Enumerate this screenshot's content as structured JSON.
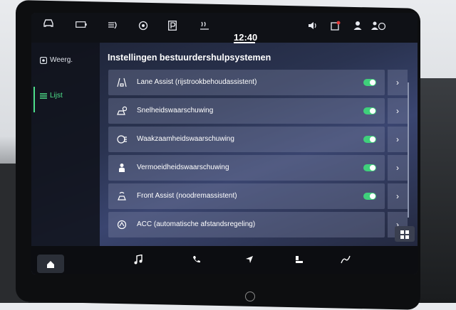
{
  "topbar": {
    "time": "12:40",
    "icons": [
      "car-icon",
      "battery-icon",
      "lights-icon",
      "tire-icon",
      "parking-icon",
      "climate-icon",
      "volume-icon",
      "notification-icon",
      "user-icon",
      "connectivity-icon"
    ],
    "notification_color": "#e23a3a"
  },
  "sidebar": {
    "items": [
      {
        "label": "Weerg.",
        "icon": "display-icon",
        "active": false
      },
      {
        "label": "Lijst",
        "icon": "list-icon",
        "active": true
      }
    ]
  },
  "page": {
    "title": "Instellingen bestuurdershulpsystemen"
  },
  "assist_list": [
    {
      "label": "Lane Assist (rijstrookbehoudassistent)",
      "icon": "lane-assist-icon",
      "enabled": true
    },
    {
      "label": "Snelheidswaarschuwing",
      "icon": "speed-warning-icon",
      "enabled": true
    },
    {
      "label": "Waakzaamheidswaarschuwing",
      "icon": "attention-warning-icon",
      "enabled": true
    },
    {
      "label": "Vermoeidheidswaarschuwing",
      "icon": "fatigue-warning-icon",
      "enabled": true
    },
    {
      "label": "Front Assist (noodremassistent)",
      "icon": "front-assist-icon",
      "enabled": true
    },
    {
      "label": "ACC (automatische afstandsregeling)",
      "icon": "acc-icon",
      "enabled": null
    }
  ],
  "bottombar": {
    "icons": [
      "home-icon",
      "music-icon",
      "phone-icon",
      "navigation-icon",
      "car-settings-icon",
      "connectivity-icon",
      "apps-grid-icon"
    ]
  },
  "colors": {
    "accent": "#3fd07b",
    "topbar_bg": "#0f1116",
    "row_bg": "#5d6482"
  }
}
